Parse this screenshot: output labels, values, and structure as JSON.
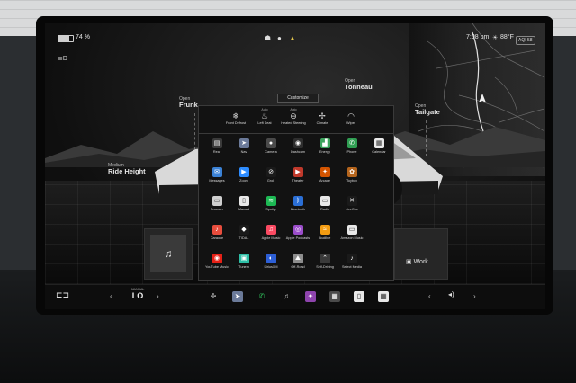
{
  "status_bar": {
    "battery_percent": 74,
    "battery_text": "74 %",
    "time": "7:08 pm",
    "temperature": "88°F",
    "aqi_label": "AQI",
    "aqi_value": "58"
  },
  "vehicle_callouts": {
    "frunk": {
      "state": "Open",
      "label": "Frunk"
    },
    "tonneau": {
      "state": "Open",
      "label": "Tonneau"
    },
    "tailgate": {
      "state": "Open",
      "label": "Tailgate"
    },
    "ride_height": {
      "state": "Medium",
      "label": "Ride Height"
    }
  },
  "customize_label": "Customize",
  "quick_controls": [
    {
      "top": "",
      "label": "Front Defrost",
      "icon": "front-defrost-icon",
      "glyph": "❄"
    },
    {
      "top": "Auto",
      "label": "Left Seat",
      "icon": "seat-heat-icon",
      "glyph": "♨"
    },
    {
      "top": "Auto",
      "label": "Heated Steering",
      "icon": "steering-wheel-icon",
      "glyph": "⊖"
    },
    {
      "top": "",
      "label": "Climate",
      "icon": "fan-icon",
      "glyph": "✢"
    },
    {
      "top": "",
      "label": "Wiper",
      "icon": "wiper-icon",
      "glyph": "◠"
    }
  ],
  "apps": [
    [
      {
        "label": "Rear",
        "icon": "rear-seat-icon",
        "color": "#3a3a3a",
        "glyph": "▤"
      },
      {
        "label": "Nav",
        "icon": "navigation-icon",
        "color": "#6b7a99",
        "glyph": "➤"
      },
      {
        "label": "Camera",
        "icon": "camera-icon",
        "color": "#4a4a4a",
        "glyph": "●"
      },
      {
        "label": "Dashcam",
        "icon": "dashcam-icon",
        "color": "#2e2e2e",
        "glyph": "◉"
      },
      {
        "label": "Energy",
        "icon": "energy-icon",
        "color": "#3da35d",
        "glyph": "▟"
      },
      {
        "label": "Phone",
        "icon": "phone-icon",
        "color": "#2f9e52",
        "glyph": "✆"
      },
      {
        "label": "Calendar",
        "icon": "calendar-icon",
        "color": "#e8e8e8",
        "glyph": "▦"
      }
    ],
    [
      {
        "label": "Messages",
        "icon": "messages-icon",
        "color": "#3b82d6",
        "glyph": "✉"
      },
      {
        "label": "Zoom",
        "icon": "zoom-icon",
        "color": "#2d8cff",
        "glyph": "▶"
      },
      {
        "label": "Grok",
        "icon": "grok-icon",
        "color": "#1a1a1a",
        "glyph": "⊘"
      },
      {
        "label": "Theater",
        "icon": "theater-icon",
        "color": "#c0392b",
        "glyph": "▶"
      },
      {
        "label": "Arcade",
        "icon": "arcade-icon",
        "color": "#d35400",
        "glyph": "✦"
      },
      {
        "label": "Toybox",
        "icon": "toybox-icon",
        "color": "#b5651d",
        "glyph": "✿"
      }
    ],
    [
      {
        "label": "Browser",
        "icon": "browser-icon",
        "color": "#cfcfcf",
        "glyph": "▭"
      },
      {
        "label": "Manual",
        "icon": "manual-icon",
        "color": "#e8e8e8",
        "glyph": "▯"
      },
      {
        "label": "Spotify",
        "icon": "spotify-icon",
        "color": "#1db954",
        "glyph": "≋"
      },
      {
        "label": "Bluetooth",
        "icon": "bluetooth-icon",
        "color": "#2b6fd6",
        "glyph": "ᛒ"
      },
      {
        "label": "Radio",
        "icon": "radio-icon",
        "color": "#e8e8e8",
        "glyph": "▭"
      },
      {
        "label": "LiveOne",
        "icon": "liveone-icon",
        "color": "#1a1a1a",
        "glyph": "✕"
      }
    ],
    [
      {
        "label": "Caraoke",
        "icon": "caraoke-icon",
        "color": "#e84d3d",
        "glyph": "♪"
      },
      {
        "label": "TIDAL",
        "icon": "tidal-icon",
        "color": "#1a1a1a",
        "glyph": "◆"
      },
      {
        "label": "Apple Music",
        "icon": "apple-music-icon",
        "color": "#fa4a62",
        "glyph": "♫"
      },
      {
        "label": "Apple Podcasts",
        "icon": "apple-podcasts-icon",
        "color": "#9b4dca",
        "glyph": "◎"
      },
      {
        "label": "Audible",
        "icon": "audible-icon",
        "color": "#f39c12",
        "glyph": "≈"
      },
      {
        "label": "Amazon Music",
        "icon": "amazon-music-icon",
        "color": "#e8e8e8",
        "glyph": "▭"
      }
    ],
    [
      {
        "label": "YouTube Music",
        "icon": "youtube-music-icon",
        "color": "#e62117",
        "glyph": "◉"
      },
      {
        "label": "TuneIn",
        "icon": "tunein-icon",
        "color": "#2dbfa6",
        "glyph": "▣"
      },
      {
        "label": "SiriusXM",
        "icon": "siriusxm-icon",
        "color": "#2d5fd6",
        "glyph": "◐"
      },
      {
        "label": "Off-Road",
        "icon": "off-road-icon",
        "color": "#8e8e8e",
        "glyph": "⛰"
      },
      {
        "label": "Self-Driving",
        "icon": "self-driving-icon",
        "color": "#3a3a3a",
        "glyph": "⌃"
      },
      {
        "label": "Select Media",
        "icon": "select-media-icon",
        "color": "#1a1a1a",
        "glyph": "♪"
      }
    ]
  ],
  "home_card_label": "Work",
  "taskbar": {
    "climate_mode": "MANUAL",
    "temperature": "LO",
    "dock": [
      {
        "icon": "fan-icon",
        "color": "#0d0d0d",
        "glyph": "✢"
      },
      {
        "icon": "navigation-icon",
        "color": "#6b7a99",
        "glyph": "➤"
      },
      {
        "icon": "phone-icon",
        "color": "#0d0d0d",
        "glyph": "✆"
      },
      {
        "icon": "music-icon",
        "color": "#0d0d0d",
        "glyph": "♫"
      },
      {
        "icon": "arcade-icon",
        "color": "#8e44ad",
        "glyph": "✦"
      },
      {
        "icon": "app-launcher-icon",
        "color": "#4a4a4a",
        "glyph": "▦"
      },
      {
        "icon": "manual-icon",
        "color": "#e8e8e8",
        "glyph": "▯"
      },
      {
        "icon": "calendar-icon",
        "color": "#e8e8e8",
        "glyph": "▦"
      }
    ]
  }
}
